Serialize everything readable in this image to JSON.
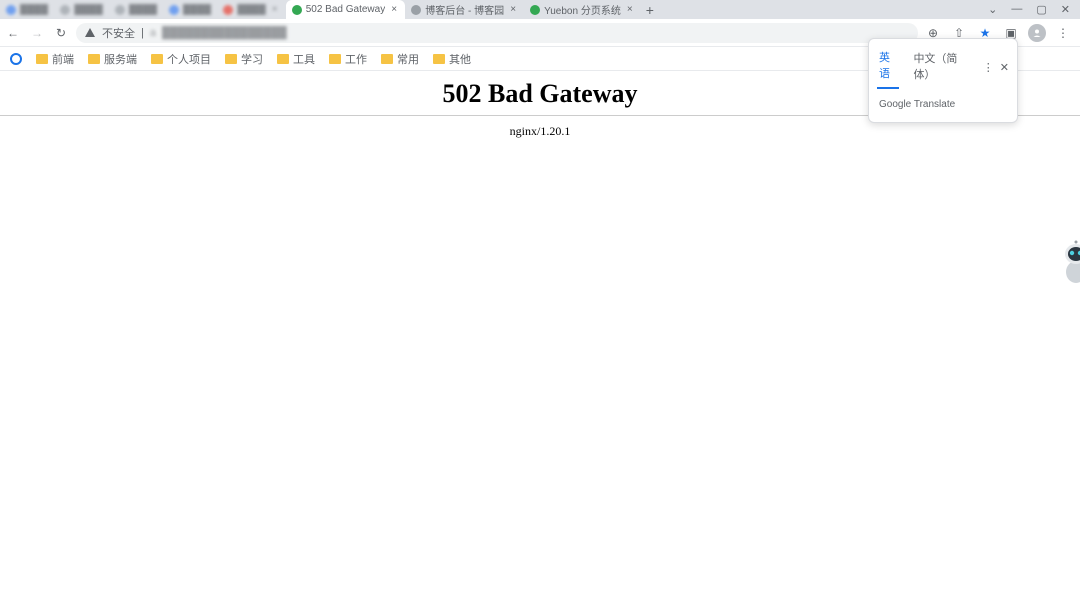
{
  "tabs": {
    "blurred_stubs": [
      "",
      "",
      "",
      "",
      "",
      ""
    ],
    "visible": [
      {
        "title": "502 Bad Gateway",
        "active": true,
        "favicon": "fav-green"
      },
      {
        "title": "博客后台 - 博客园",
        "active": false,
        "favicon": "fav-gray"
      },
      {
        "title": "Yuebon 分页系统",
        "active": false,
        "favicon": "fav-green"
      }
    ],
    "new_tab_glyph": "+"
  },
  "window_controls": {
    "chevron": "⌄",
    "minimize": "—",
    "maximize": "▢",
    "close": "✕"
  },
  "nav": {
    "back": "←",
    "forward": "→",
    "reload": "↻"
  },
  "address": {
    "warning_label": "不安全",
    "warning_glyph": "▲",
    "url_masked": "a"
  },
  "right_icons": {
    "translate": "⊕",
    "share": "⇧",
    "star": "★",
    "panel": "▣",
    "menu": "⋮"
  },
  "bookmarks": [
    {
      "kind": "apps",
      "label": ""
    },
    {
      "kind": "folder",
      "label": "前端"
    },
    {
      "kind": "folder",
      "label": "服务端"
    },
    {
      "kind": "folder",
      "label": "个人项目"
    },
    {
      "kind": "folder",
      "label": "学习"
    },
    {
      "kind": "folder",
      "label": "工具"
    },
    {
      "kind": "folder",
      "label": "工作"
    },
    {
      "kind": "folder",
      "label": "常用"
    },
    {
      "kind": "folder",
      "label": "其他"
    }
  ],
  "page": {
    "heading": "502 Bad Gateway",
    "server": "nginx/1.20.1"
  },
  "translate": {
    "tab_active": "英语",
    "tab_other": "中文（简体）",
    "menu_glyph": "⋮",
    "close_glyph": "✕",
    "provider": "Google Translate"
  }
}
